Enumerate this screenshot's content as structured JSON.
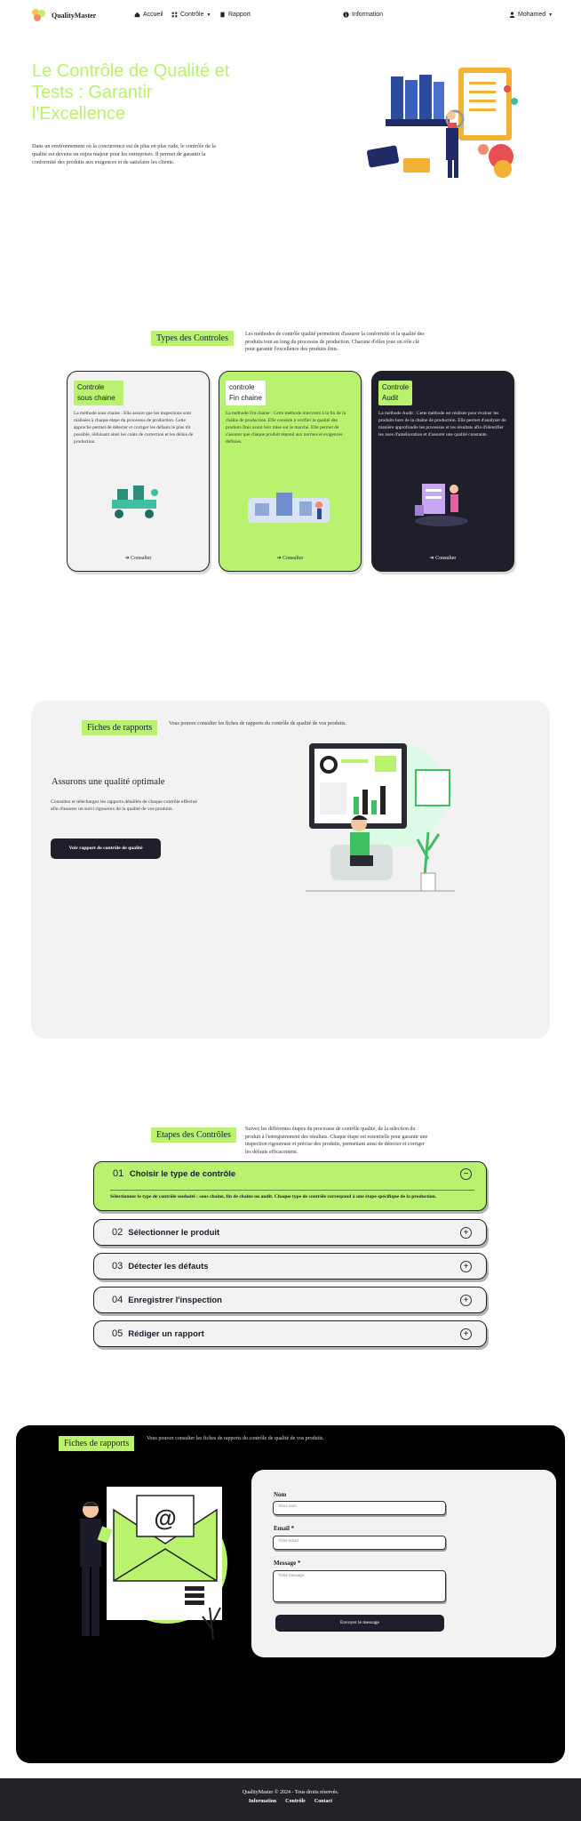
{
  "nav": {
    "brand": "QualityMaster",
    "accueil": "Accueil",
    "controles": "Contrôle",
    "rapport": "Rapport",
    "information": "Information",
    "user": "Mohamed"
  },
  "hero": {
    "title": "Le Contrôle de Qualité et Tests : Garantir l'Excellence",
    "text": "Dans un environnement où la concurrence est de plus en plus rude, le contrôle de la qualité est devenu un enjeu majeur pour les entreprises. Il permet de garantir la conformité des produits aux exigences et de satisfaire les clients."
  },
  "types": {
    "label": "Types des Controles",
    "desc": "Les méthodes de contrôle qualité permettent d'assurer la conformité et la qualité des produits tout au long du processus de production. Chacune d'elles joue un rôle clé pour garantir l'excellence des produits finis.",
    "cards": [
      {
        "badge": "Controle sous chaine",
        "text": "La méthode sous chaine : Elle assure que les inspections sont réalisées à chaque étape du processus de production. Cette approche permet de détecter et corriger les défauts le plus tôt possible, réduisant ainsi les coûts de correction et les délais de production.",
        "link": "Consulter"
      },
      {
        "badge": "controle Fin chaine",
        "text": "La méthode Fin chaine : Cette méthode intervient à la fin de la chaîne de production. Elle consiste à vérifier la qualité des produits finis avant leur mise sur le marché. Elle permet de s'assurer que chaque produit répond aux normes et exigences définies.",
        "link": "Consulter"
      },
      {
        "badge": "Controle Audit",
        "text": "La méthode Audit : Cette méthode est réalisée pour évaluer les produits hors de la chaîne de production. Elle permet d'analyser de manière approfondie les processus et les résultats afin d'identifier les axes d'amélioration et d'assurer une qualité constante.",
        "link": "Consulter"
      }
    ]
  },
  "reports": {
    "label": "Fiches de rapports",
    "desc": "Vous pouvez consulter les fiches de rapports du contrôle de qualité de vos produits.",
    "heading": "Assurons une qualité optimale",
    "text": "Consultez et téléchargez les rapports détaillés de chaque contrôle effectué afin d'assurer un suivi rigoureux de la qualité de vos produits.",
    "button": "Voir rapport de contrôle de qualité"
  },
  "steps": {
    "label": "Etapes des Contrôles",
    "desc": "Suivez les différentes étapes du processus de contrôle qualité, de la sélection du produit à l'enregistrement des résultats. Chaque étape est essentielle pour garantir une inspection rigoureuse et précise des produits, permettant ainsi de détecter et corriger les défauts efficacement.",
    "items": [
      {
        "num": "01",
        "title": "Choisir le type de contrôle",
        "sign": "−",
        "body": "Sélectionner le type de contrôle souhaité : sous chaine, fin de chaine ou audit. Chaque type de contrôle correspond à une étape spécifique de la production."
      },
      {
        "num": "02",
        "title": "Sélectionner le produit",
        "sign": "+"
      },
      {
        "num": "03",
        "title": "Détecter les défauts",
        "sign": "+"
      },
      {
        "num": "04",
        "title": "Enregistrer l'inspection",
        "sign": "+"
      },
      {
        "num": "05",
        "title": "Rédiger un rapport",
        "sign": "+"
      }
    ]
  },
  "contact": {
    "label": "Fiches de rapports",
    "desc": "Vous pouvez consulter les fiches de rapports du contrôle de qualité de vos produits.",
    "name_label": "Nom",
    "name_placeholder": "Votre nom",
    "email_label": "Email *",
    "email_placeholder": "Votre email",
    "message_label": "Message *",
    "message_placeholder": "Votre message",
    "button": "Envoyer le message"
  },
  "footer": {
    "copyright": "QualityMaster © 2024 - Tous droits réservés.",
    "links": [
      "Information",
      "Contrôle",
      "Contact"
    ]
  },
  "colors": {
    "accent": "#b8f26e",
    "dark": "#1f1f2b",
    "black": "#000000",
    "panel": "#f2f2f2"
  }
}
